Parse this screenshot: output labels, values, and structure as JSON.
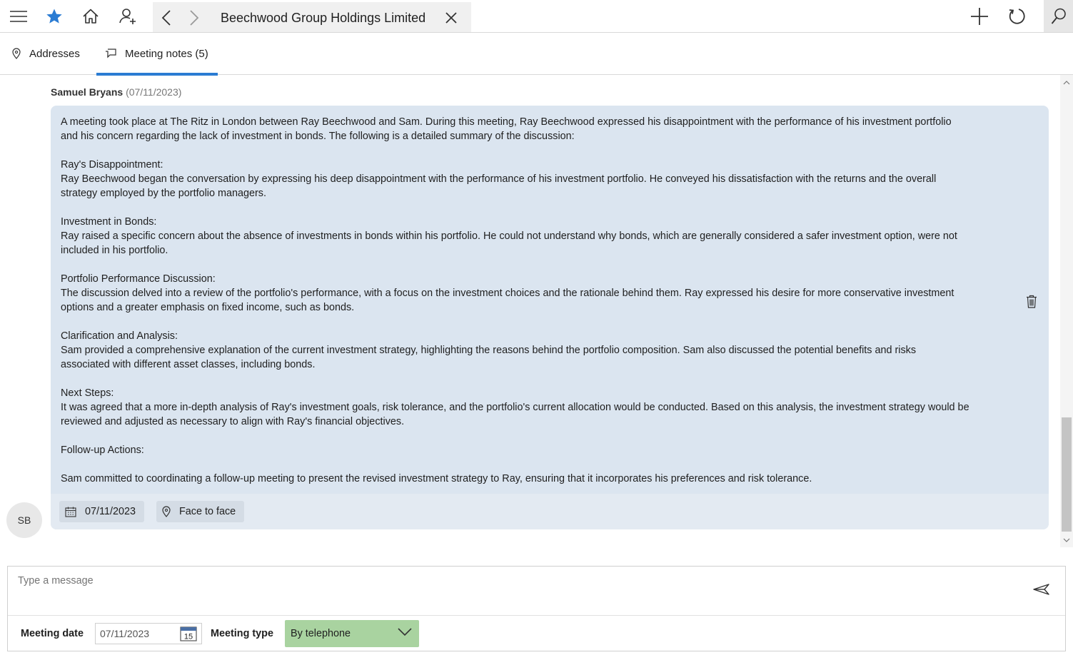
{
  "topbar": {
    "icons": [
      "menu-icon",
      "star-icon",
      "home-icon",
      "add-person-icon",
      "back-icon",
      "forward-icon",
      "close-icon",
      "plus-icon",
      "refresh-icon",
      "search-icon"
    ],
    "record_title": "Beechwood Group Holdings Limited",
    "accent_color": "#2b7cd3"
  },
  "tabs": [
    {
      "label": "Addresses",
      "icon": "location-pin-icon",
      "active": false
    },
    {
      "label": "Meeting notes (5)",
      "icon": "chat-icon",
      "active": true
    }
  ],
  "note": {
    "author": "Samuel Bryans",
    "date_paren": "(07/11/2023)",
    "paragraphs": [
      [
        "A meeting took place at The Ritz in London between Ray Beechwood and Sam. During this meeting, Ray Beechwood expressed his disappointment with the performance of his investment portfolio",
        "and his concern regarding the lack of investment in bonds. The following is a detailed summary of the discussion:"
      ],
      [
        "Ray's Disappointment:",
        "Ray Beechwood began the conversation by expressing his deep disappointment with the performance of his investment portfolio. He conveyed his dissatisfaction with the returns and the overall",
        "strategy employed by the portfolio managers."
      ],
      [
        "Investment in Bonds:",
        "Ray raised a specific concern about the absence of investments in bonds within his portfolio. He could not understand why bonds, which are generally considered a safer investment option, were not",
        "included in his portfolio."
      ],
      [
        "Portfolio Performance Discussion:",
        "The discussion delved into a review of the portfolio's performance, with a focus on the investment choices and the rationale behind them. Ray expressed his desire for more conservative investment",
        "options and a greater emphasis on fixed income, such as bonds."
      ],
      [
        "Clarification and Analysis:",
        "Sam provided a comprehensive explanation of the current investment strategy, highlighting the reasons behind the portfolio composition. Sam also discussed the potential benefits and risks",
        "associated with different asset classes, including bonds."
      ],
      [
        "Next Steps:",
        "It was agreed that a more in-depth analysis of Ray's investment goals, risk tolerance, and the portfolio's current allocation would be conducted. Based on this analysis, the investment strategy would be",
        "reviewed and adjusted as necessary to align with Ray's financial objectives."
      ],
      [
        "Follow-up Actions:"
      ],
      [
        "Sam committed to coordinating a follow-up meeting to present the revised investment strategy to Ray, ensuring that it incorporates his preferences and risk tolerance."
      ]
    ],
    "meeting_date": "07/11/2023",
    "meeting_type": "Face to face",
    "avatar_initials": "SB",
    "bubble_color": "#dbe5f0"
  },
  "composer": {
    "placeholder": "Type a message",
    "meeting_date_label": "Meeting date",
    "meeting_date_value": "07/11/2023",
    "calendar_day": "15",
    "meeting_type_label": "Meeting type",
    "meeting_type_value": "By telephone",
    "select_color": "#a9d3a0"
  }
}
